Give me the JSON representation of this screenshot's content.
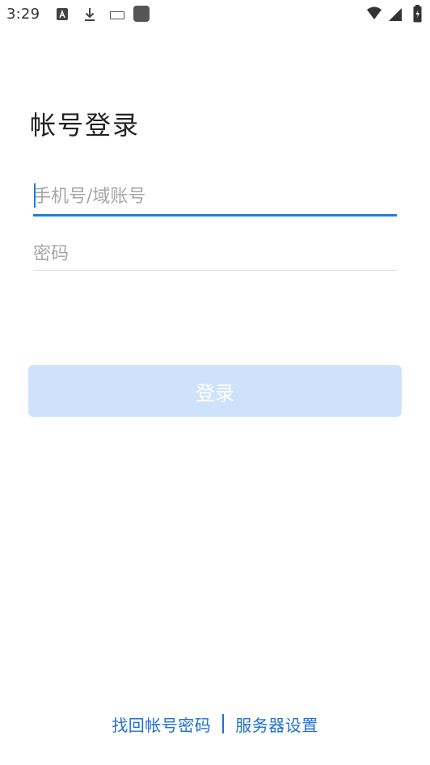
{
  "status_bar": {
    "time": "3:29",
    "icons": [
      "a-notification-icon",
      "download-icon",
      "keyboard-icon",
      "app-square-icon",
      "wifi-icon",
      "signal-icon",
      "battery-icon"
    ]
  },
  "login": {
    "title": "帐号登录",
    "account_placeholder": "手机号/域账号",
    "password_placeholder": "密码",
    "login_button_label": "登录"
  },
  "footer": {
    "recover_label": "找回帐号密码",
    "server_settings_label": "服务器设置"
  },
  "colors": {
    "accent": "#1f7fd9",
    "link": "#1f6fd6",
    "disabled_button": "#cfe2fb"
  }
}
